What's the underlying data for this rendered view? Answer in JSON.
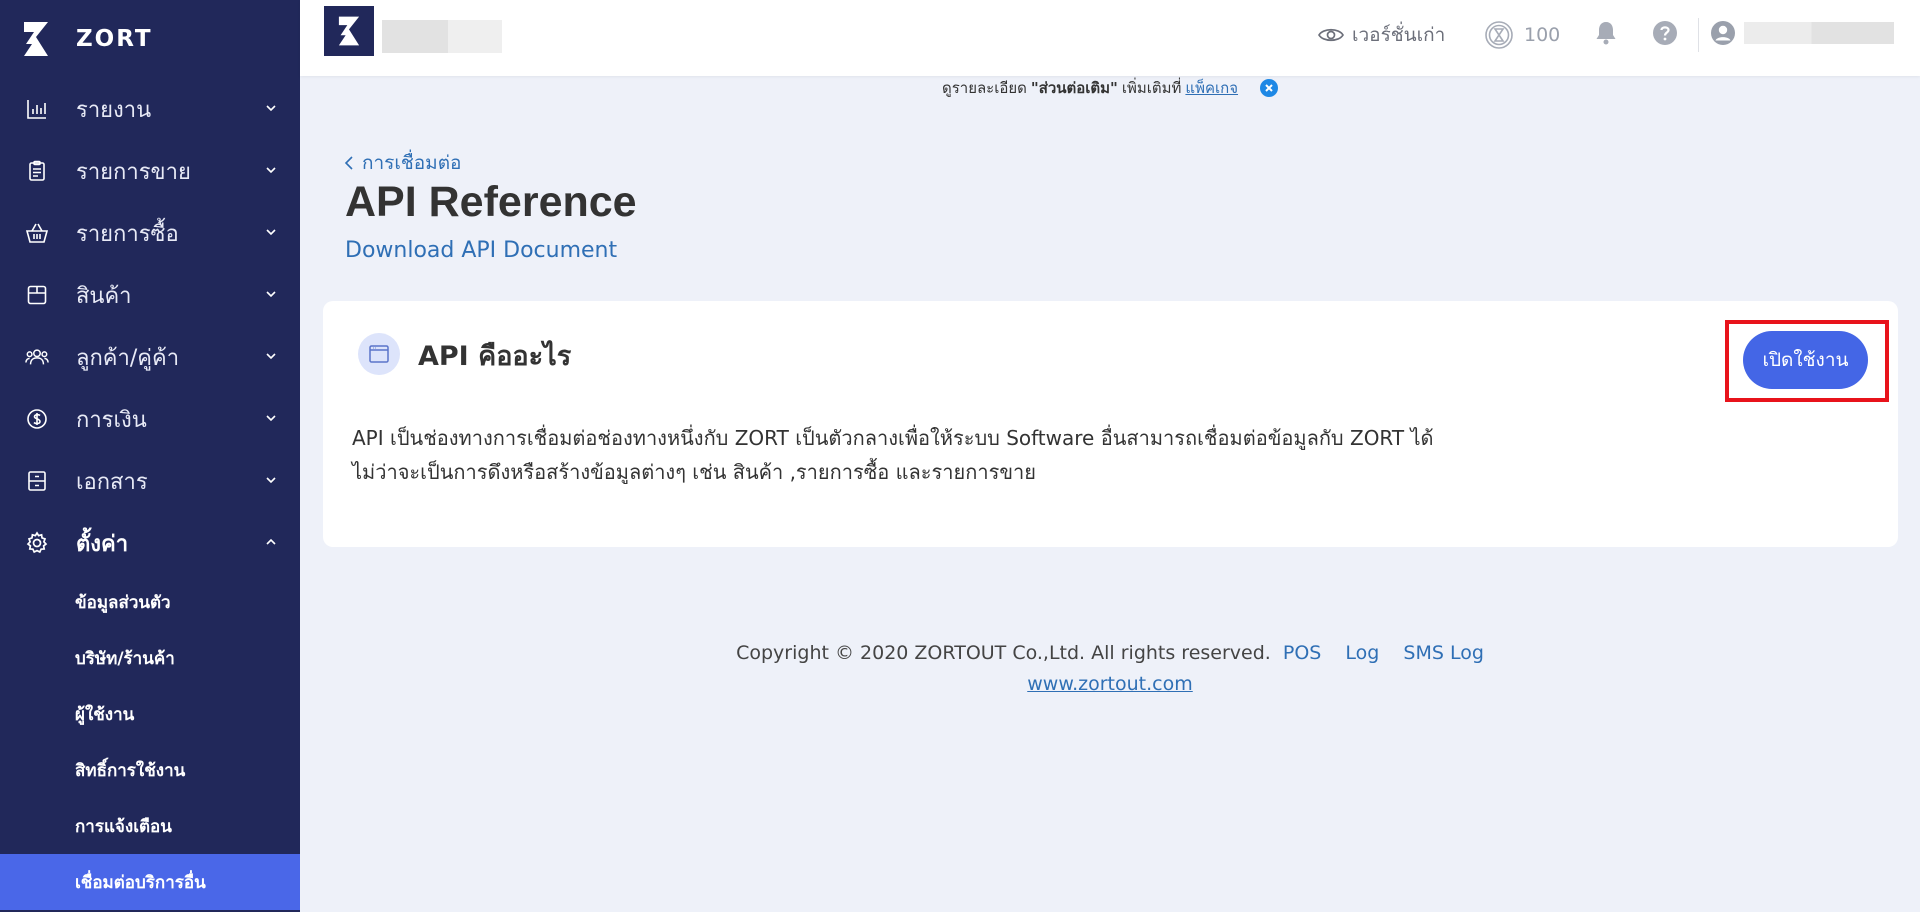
{
  "sidebar": {
    "brand": "ZORT",
    "menu": [
      {
        "label": "รายงาน",
        "icon": "bar-chart-icon"
      },
      {
        "label": "รายการขาย",
        "icon": "clipboard-icon"
      },
      {
        "label": "รายการซื้อ",
        "icon": "basket-icon"
      },
      {
        "label": "สินค้า",
        "icon": "box-icon"
      },
      {
        "label": "ลูกค้า/คู่ค้า",
        "icon": "users-icon"
      },
      {
        "label": "การเงิน",
        "icon": "dollar-circle-icon"
      },
      {
        "label": "เอกสาร",
        "icon": "cabinet-icon"
      },
      {
        "label": "ตั้งค่า",
        "icon": "gear-icon"
      }
    ],
    "submenu": [
      {
        "label": "ข้อมูลส่วนตัว"
      },
      {
        "label": "บริษัท/ร้านค้า"
      },
      {
        "label": "ผู้ใช้งาน"
      },
      {
        "label": "สิทธิ์การใช้งาน"
      },
      {
        "label": "การแจ้งเตือน"
      },
      {
        "label": "เชื่อมต่อบริการอื่น"
      }
    ]
  },
  "topbar": {
    "old_version_label": "เวอร์ชั่นเก่า",
    "credit_count": "100"
  },
  "notice": {
    "prefix": "ดูรายละเอียด",
    "bold": "\"ส่วนต่อเติม\"",
    "middle": "เพิ่มเติมที่",
    "link": "แพ็คเกจ"
  },
  "page": {
    "breadcrumb": "การเชื่อมต่อ",
    "title": "API Reference",
    "download_link": "Download API Document"
  },
  "card": {
    "title": "API คืออะไร",
    "button_label": "เปิดใช้งาน",
    "description_line1": "API เป็นช่องทางการเชื่อมต่อช่องทางหนึ่งกับ ZORT เป็นตัวกลางเพื่อให้ระบบ Software อื่นสามารถเชื่อมต่อข้อมูลกับ ZORT ได้",
    "description_line2": "ไม่ว่าจะเป็นการดึงหรือสร้างข้อมูลต่างๆ เช่น สินค้า ,รายการซื้อ และรายการขาย"
  },
  "footer": {
    "copyright": "Copyright © 2020 ZORTOUT Co.,Ltd. All rights reserved.",
    "links": [
      "POS",
      "Log",
      "SMS Log"
    ],
    "website": "www.zortout.com"
  },
  "colors": {
    "sidebar_bg": "#21285a",
    "accent": "#4466e6",
    "link": "#2f6fb5",
    "highlight": "#e8131b",
    "page_bg": "#eef1f9"
  }
}
